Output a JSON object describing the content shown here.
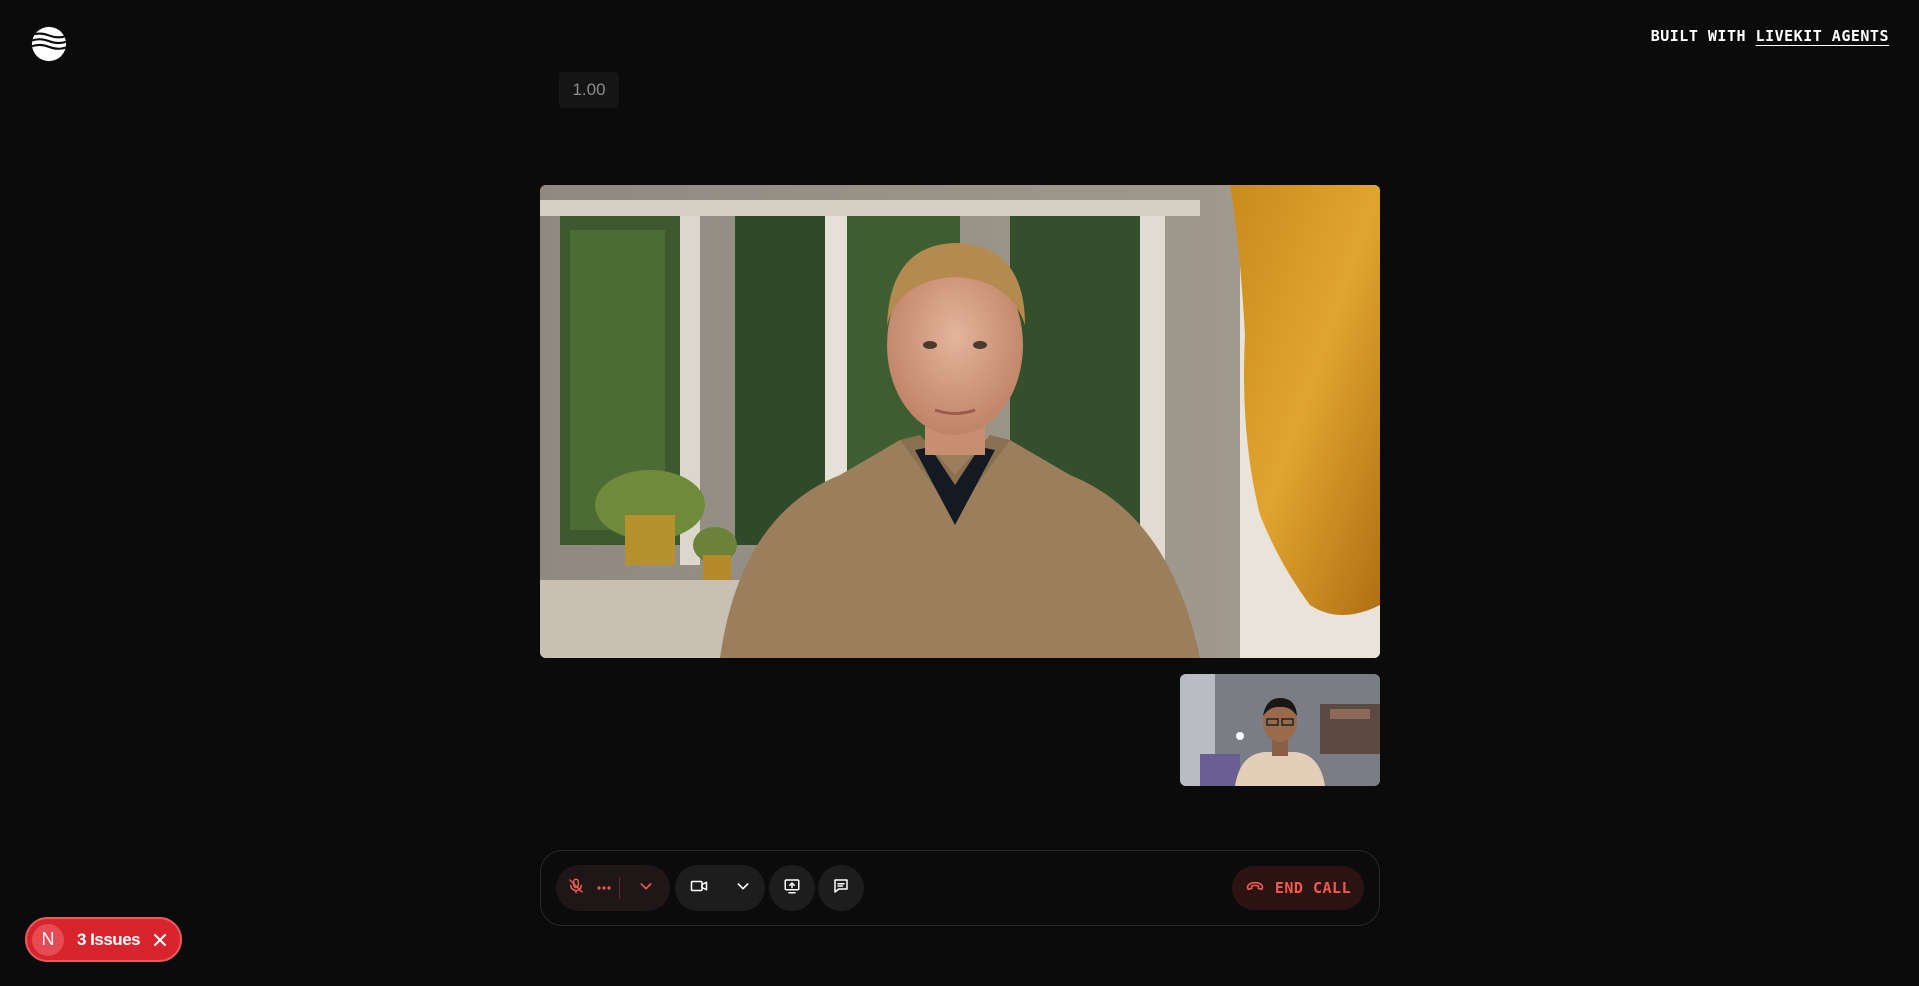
{
  "header": {
    "logo_icon": "livekit-waves-logo",
    "built_with_prefix": "BUILT WITH",
    "built_with_link": "LIVEKIT AGENTS"
  },
  "counter_value": "1.00",
  "videos": {
    "agent": "agent-video-feed",
    "local": "local-camera-feed"
  },
  "controls": {
    "mic_icon": "microphone-off-icon",
    "camera_icon": "video-camera-icon",
    "share_icon": "screen-share-icon",
    "chat_icon": "chat-icon",
    "end_call_icon": "phone-hangup-icon",
    "end_call_label": "END CALL",
    "accent": "#f05a4f"
  },
  "issues_badge": {
    "avatar_letter": "N",
    "label": "3 Issues",
    "color": "#d8242c"
  }
}
